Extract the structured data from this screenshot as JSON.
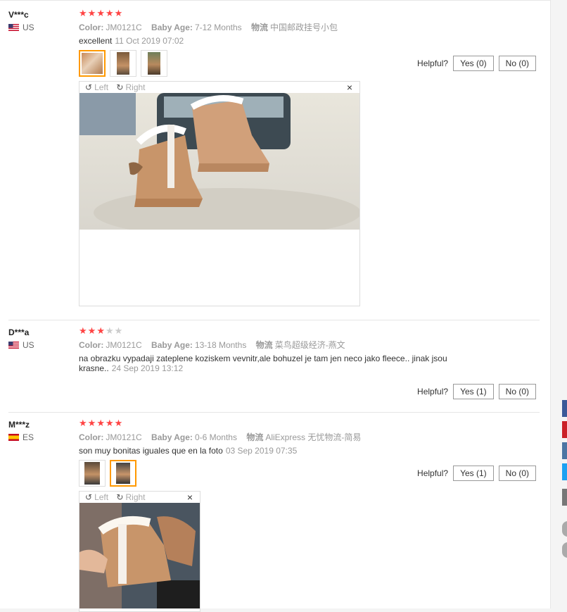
{
  "helpful_label": "Helpful?",
  "attr_labels": {
    "color": "Color:",
    "baby_age": "Baby Age:",
    "shipping": "物流"
  },
  "viewer": {
    "left": "Left",
    "right": "Right",
    "close": "×"
  },
  "reviews": [
    {
      "user": "V***c",
      "country": "US",
      "stars": 5,
      "color": "JM0121C",
      "baby_age": "7-12 Months",
      "shipping": "中国邮政挂号小包",
      "text": "excellent",
      "date": "11 Oct 2019 07:02",
      "yes": "Yes (0)",
      "no": "No (0)"
    },
    {
      "user": "D***a",
      "country": "US",
      "stars": 3,
      "color": "JM0121C",
      "baby_age": "13-18 Months",
      "shipping": "菜鸟超级经济-燕文",
      "text": "na obrazku vypadaji zateplene koziskem vevnitr,ale bohuzel je tam jen neco jako fleece.. jinak jsou krasne..",
      "date": "24 Sep 2019 13:12",
      "yes": "Yes (1)",
      "no": "No (0)"
    },
    {
      "user": "M***z",
      "country": "ES",
      "stars": 5,
      "color": "JM0121C",
      "baby_age": "0-6 Months",
      "shipping": "AliExpress 无忧物流-简易",
      "text": "son muy bonitas iguales que en la foto",
      "date": "03 Sep 2019 07:35",
      "yes": "Yes (1)",
      "no": "No (0)"
    }
  ],
  "colors": {
    "star": "#ff4444",
    "accent": "#ff9900",
    "facebook": "#3b5998",
    "pinterest": "#cb2027",
    "vk": "#4c75a3",
    "twitter": "#1da1f2"
  }
}
